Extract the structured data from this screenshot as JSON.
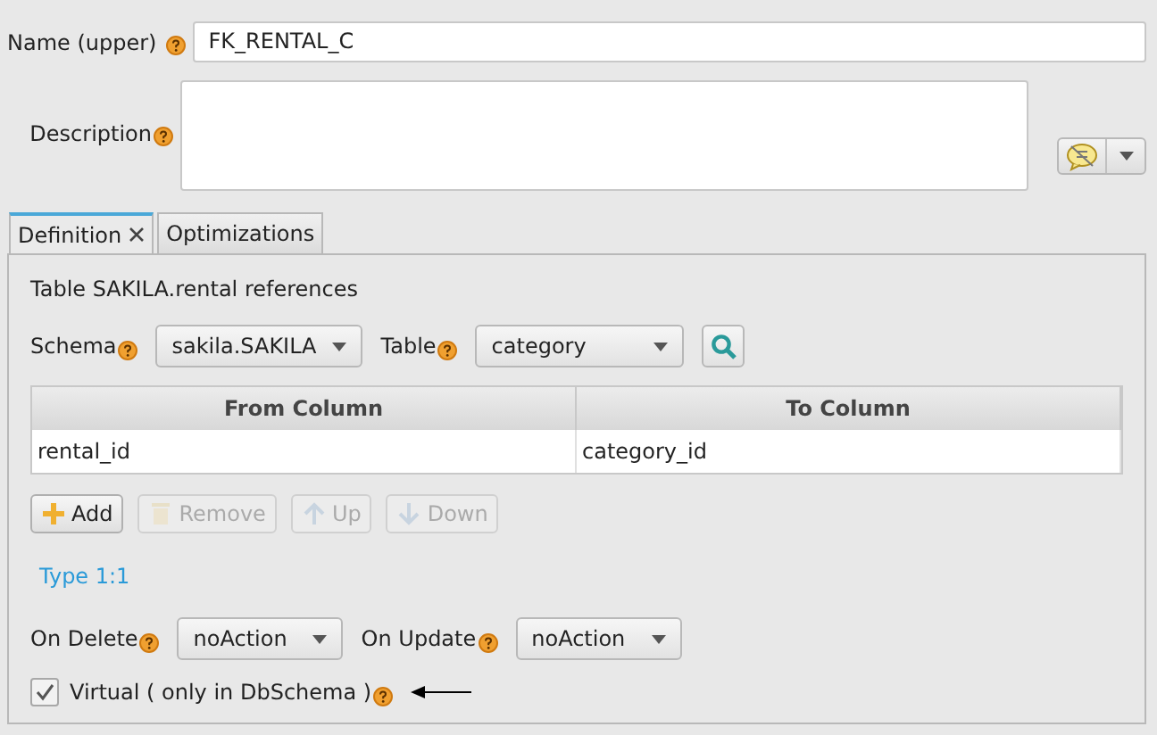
{
  "name_field": {
    "label": "Name (upper)",
    "value": "FK_RENTAL_C"
  },
  "description_field": {
    "label": "Description"
  },
  "tabs": [
    {
      "label": "Definition",
      "selected": true,
      "closable": true
    },
    {
      "label": "Optimizations",
      "selected": false,
      "closable": false
    }
  ],
  "definition": {
    "heading": "Table SAKILA.rental references",
    "schema": {
      "label": "Schema",
      "value": "sakila.SAKILA"
    },
    "table": {
      "label": "Table",
      "value": "category"
    },
    "columns": [
      "From Column",
      "To Column"
    ],
    "rows": [
      [
        "rental_id",
        "category_id"
      ]
    ],
    "buttons": [
      {
        "label": "Add",
        "kind": "add",
        "disabled": false
      },
      {
        "label": "Remove",
        "kind": "remove",
        "disabled": true
      },
      {
        "label": "Up",
        "kind": "up",
        "disabled": true
      },
      {
        "label": "Down",
        "kind": "down",
        "disabled": true
      }
    ],
    "type_link": "Type 1:1",
    "on_delete": {
      "label": "On Delete",
      "value": "noAction"
    },
    "on_update": {
      "label": "On Update",
      "value": "noAction"
    },
    "virtual": {
      "label": "Virtual ( only in DbSchema )",
      "checked": true
    }
  }
}
